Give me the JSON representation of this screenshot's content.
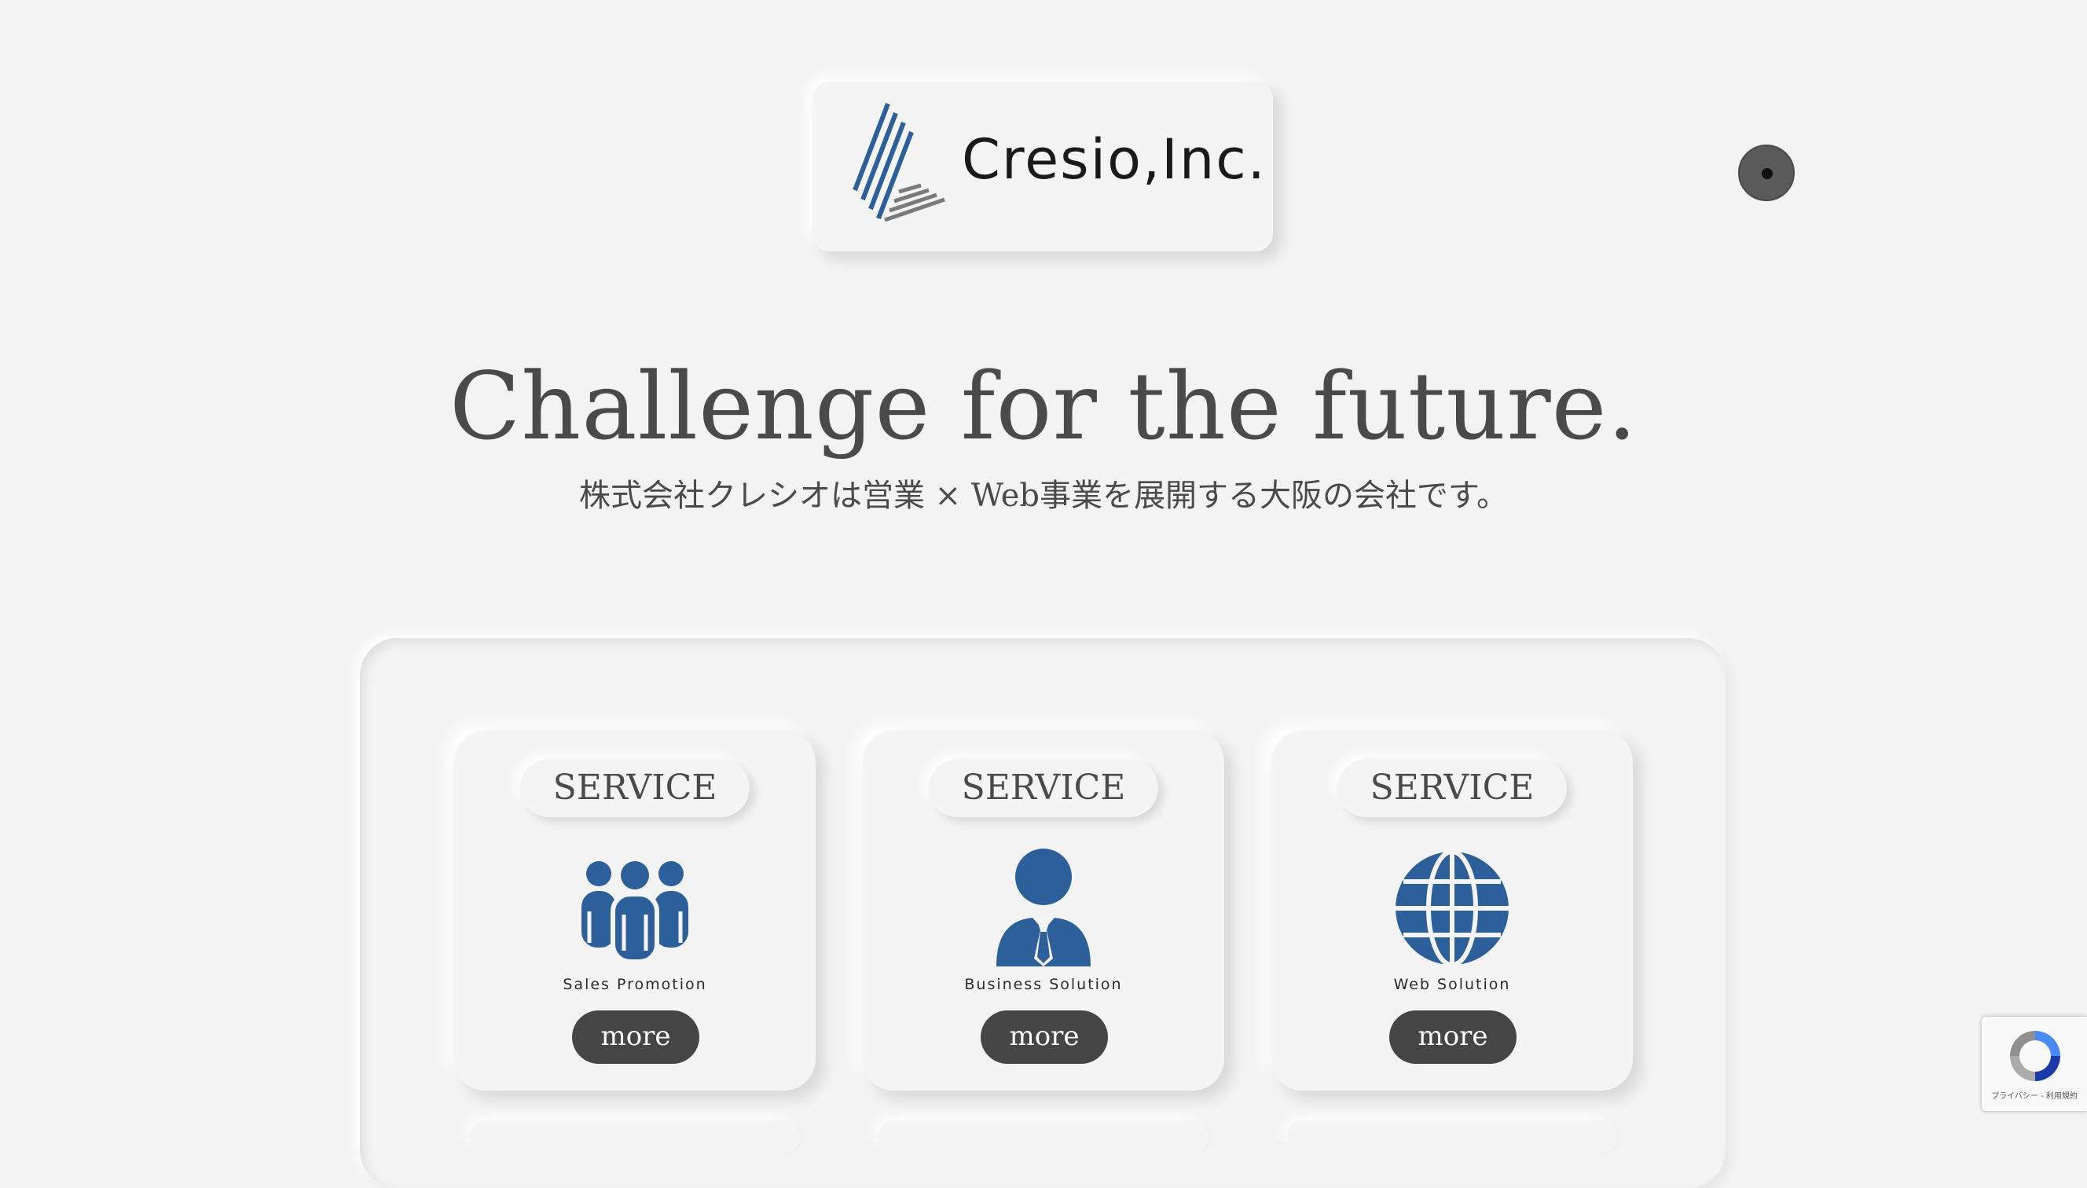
{
  "brand": {
    "name": "Cresio,Inc.",
    "logo_icon": "striped-triangle-logo-icon"
  },
  "header": {
    "menu_icon": "menu-dot-icon"
  },
  "hero": {
    "title": "Challenge for the future.",
    "subtitle": "株式会社クレシオは営業 × Web事業を展開する大阪の会社です。"
  },
  "services": [
    {
      "tag": "SERVICE",
      "icon": "people-group-icon",
      "caption": "Sales Promotion",
      "more_label": "more"
    },
    {
      "tag": "SERVICE",
      "icon": "businessman-icon",
      "caption": "Business Solution",
      "more_label": "more"
    },
    {
      "tag": "SERVICE",
      "icon": "globe-icon",
      "caption": "Web Solution",
      "more_label": "more"
    }
  ],
  "recaptcha": {
    "text": "プライバシー - 利用規約",
    "icon": "recaptcha-icon"
  },
  "colors": {
    "background": "#f3f3f3",
    "accent_blue": "#2d5f9a",
    "dark_button": "#454545",
    "text": "#4a4a4a"
  }
}
